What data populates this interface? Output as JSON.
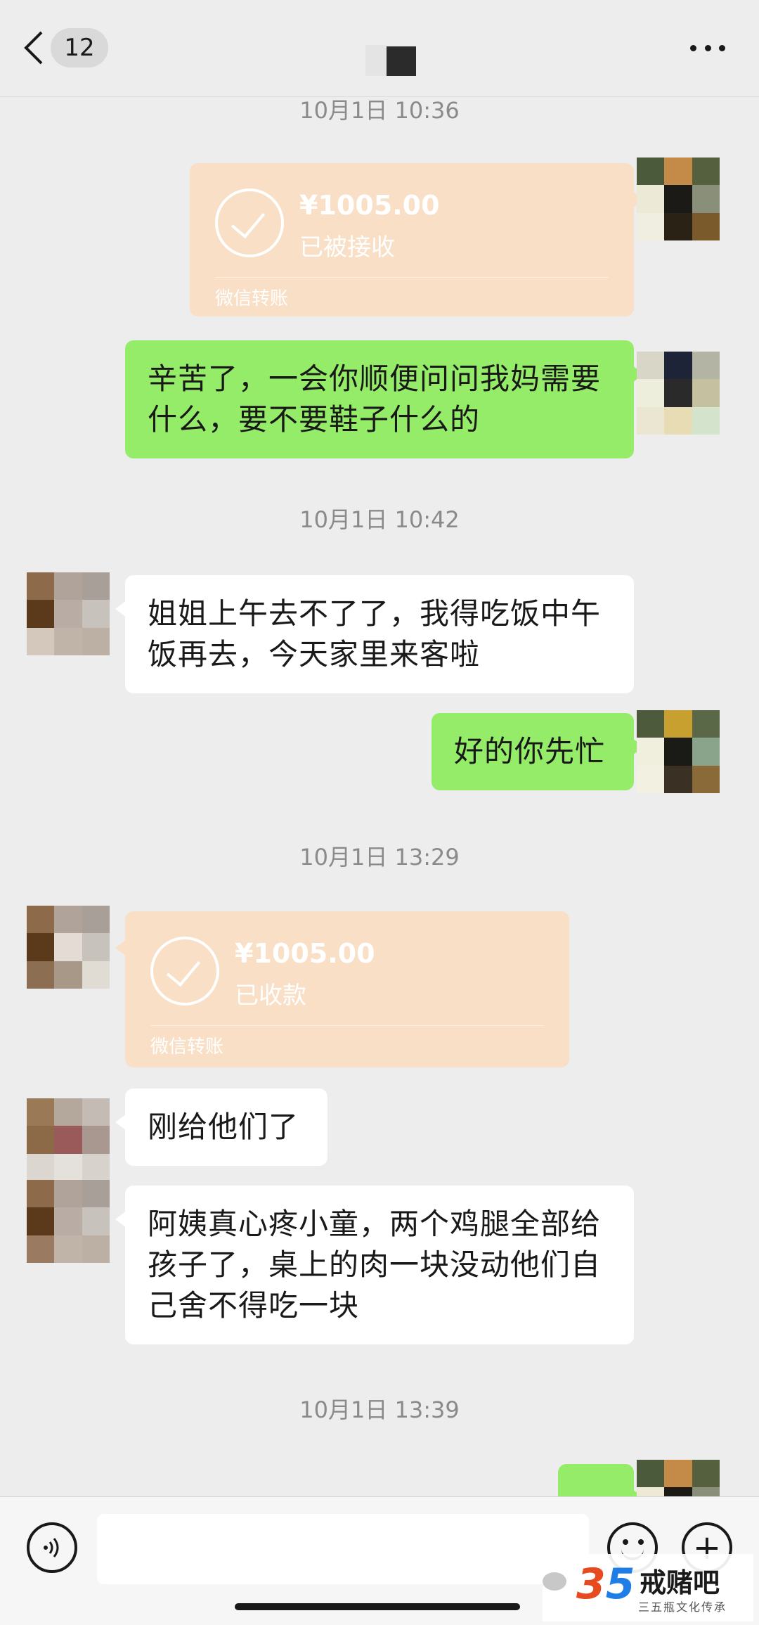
{
  "header": {
    "badge_count": "12"
  },
  "messages": {
    "t1": "10月1日 10:36",
    "tr1": {
      "amount": "¥1005.00",
      "status": "已被接收",
      "label": "微信转账"
    },
    "m1": "辛苦了，一会你顺便问问我妈需要什么，要不要鞋子什么的",
    "t2": "10月1日 10:42",
    "m2": "姐姐上午去不了了，我得吃饭中午饭再去，今天家里来客啦",
    "m3": "好的你先忙",
    "t3": "10月1日 13:29",
    "tr2": {
      "amount": "¥1005.00",
      "status": "已收款",
      "label": "微信转账"
    },
    "m4": "刚给他们了",
    "m5": "阿姨真心疼小童，两个鸡腿全部给孩子了，桌上的肉一块没动他们自己舍不得吃一块",
    "t4": "10月1日 13:39"
  },
  "watermark": {
    "num_a": "3",
    "num_b": "5",
    "brand": "戒赌吧",
    "sub": "三五瓶文化传承"
  },
  "colors": {
    "bg": "#ededed",
    "me_bubble": "#95ec69",
    "other_bubble": "#ffffff",
    "transfer": "#f9dfc6"
  }
}
